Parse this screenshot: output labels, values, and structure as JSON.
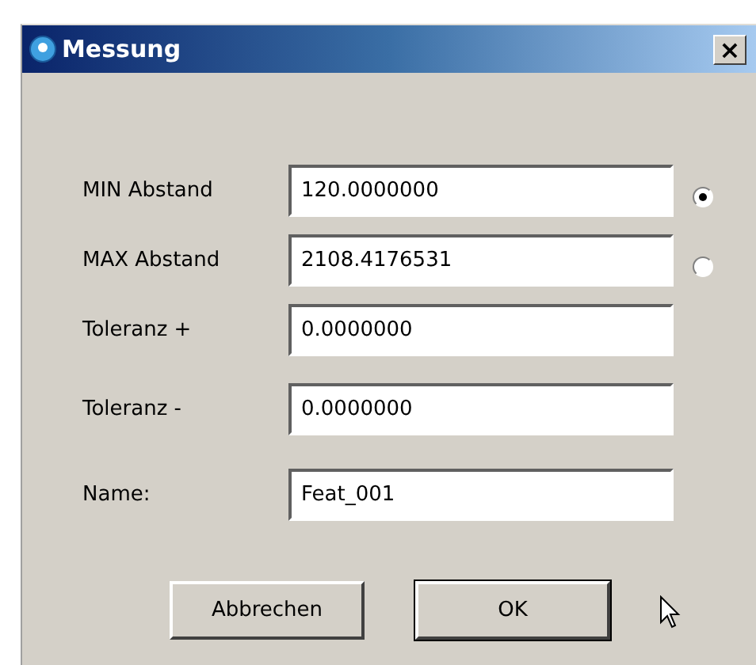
{
  "window": {
    "title": "Messung",
    "close": "×"
  },
  "fields": [
    {
      "kind": "radio",
      "label": "MIN Abstand",
      "value": "120.0000000",
      "selected": true
    },
    {
      "kind": "radio",
      "label": "MAX Abstand",
      "value": "2108.4176531",
      "selected": false
    },
    {
      "kind": "text",
      "label": "Toleranz +",
      "value": "0.0000000"
    },
    {
      "kind": "text",
      "label": "Toleranz -",
      "value": "0.0000000"
    },
    {
      "kind": "text",
      "label": "Name:",
      "value": "Feat_001"
    }
  ],
  "buttons": [
    {
      "label": "Abbrechen",
      "default": false
    },
    {
      "label": "OK",
      "default": true
    }
  ]
}
